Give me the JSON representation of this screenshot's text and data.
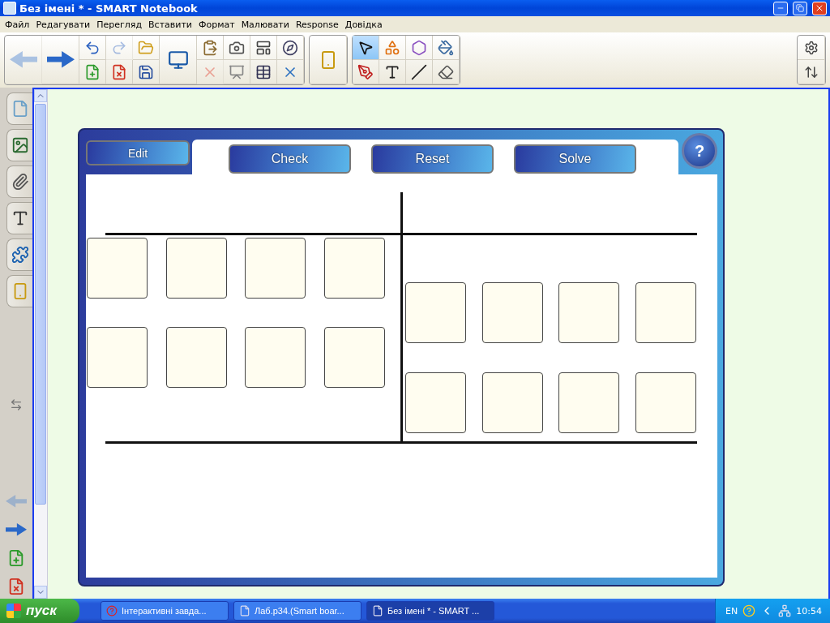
{
  "window": {
    "title": "Без імені * - SMART Notebook"
  },
  "menu": [
    "Файл",
    "Редагувати",
    "Перегляд",
    "Вставити",
    "Формат",
    "Малювати",
    "Response",
    "Довідка"
  ],
  "toolbar": {
    "buttons": [
      {
        "disabled": true
      },
      {
        "disabled": false
      },
      {
        "disabled": false
      },
      {
        "disabled": false
      },
      {
        "disabled": true
      },
      {
        "disabled": false
      },
      {
        "disabled": false
      },
      {
        "disabled": false
      },
      {
        "disabled": false
      },
      {
        "disabled": false
      },
      {
        "disabled": true
      },
      {
        "disabled": false
      },
      {
        "disabled": false
      },
      {
        "disabled": false
      },
      {
        "disabled": false
      },
      {
        "disabled": false
      },
      {
        "disabled": false
      }
    ],
    "tools": [
      {
        "selected": true
      },
      {
        "selected": false
      },
      {
        "selected": false
      },
      {
        "selected": false
      },
      {
        "selected": false
      },
      {
        "selected": false
      },
      {
        "selected": false
      },
      {
        "selected": false
      }
    ]
  },
  "sidebar": {
    "page_nav": [
      {
        "disabled": true
      },
      {
        "disabled": false
      }
    ]
  },
  "activity": {
    "edit_button": "Edit",
    "buttons": [
      "Check",
      "Reset",
      "Solve"
    ],
    "help": "?"
  },
  "taskbar": {
    "start": "пуск",
    "tasks": [
      {
        "label": "Інтерактивні завда...",
        "selected": false
      },
      {
        "label": "Лаб.р34.(Smart boar...",
        "selected": false
      },
      {
        "label": "Без імені * - SMART ...",
        "selected": true
      }
    ],
    "language": "EN",
    "time": "10:54"
  }
}
